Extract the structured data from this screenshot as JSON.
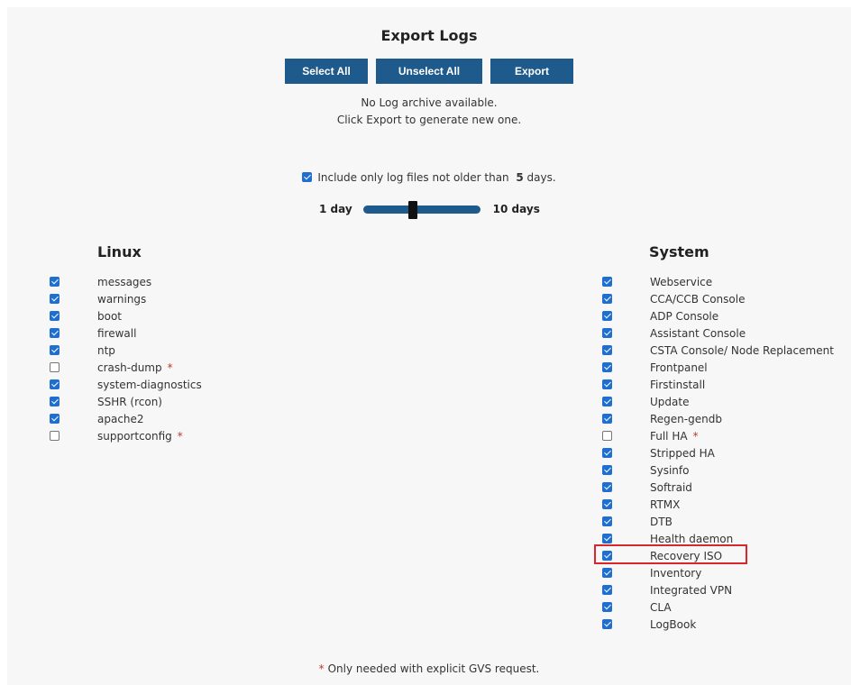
{
  "header": {
    "title": "Export Logs"
  },
  "toolbar": {
    "select_all": "Select All",
    "unselect_all": "Unselect All",
    "export": "Export"
  },
  "status": {
    "line1": "No Log archive available.",
    "line2": "Click Export to generate new one."
  },
  "filter": {
    "checked": true,
    "prefix": "Include only log files not older than",
    "days": "5",
    "suffix": "days."
  },
  "slider": {
    "min_label": "1 day",
    "max_label": "10 days",
    "value": 5,
    "min": 1,
    "max": 10
  },
  "linux": {
    "heading": "Linux",
    "items": [
      {
        "label": "messages",
        "checked": true,
        "star": false
      },
      {
        "label": "warnings",
        "checked": true,
        "star": false
      },
      {
        "label": "boot",
        "checked": true,
        "star": false
      },
      {
        "label": "firewall",
        "checked": true,
        "star": false
      },
      {
        "label": "ntp",
        "checked": true,
        "star": false
      },
      {
        "label": "crash-dump",
        "checked": false,
        "star": true
      },
      {
        "label": "system-diagnostics",
        "checked": true,
        "star": false
      },
      {
        "label": "SSHR (rcon)",
        "checked": true,
        "star": false
      },
      {
        "label": "apache2",
        "checked": true,
        "star": false
      },
      {
        "label": "supportconfig",
        "checked": false,
        "star": true
      }
    ]
  },
  "system": {
    "heading": "System",
    "items": [
      {
        "label": "Webservice",
        "checked": true,
        "star": false
      },
      {
        "label": "CCA/CCB Console",
        "checked": true,
        "star": false
      },
      {
        "label": "ADP Console",
        "checked": true,
        "star": false
      },
      {
        "label": "Assistant Console",
        "checked": true,
        "star": false
      },
      {
        "label": "CSTA Console/ Node Replacement",
        "checked": true,
        "star": false
      },
      {
        "label": "Frontpanel",
        "checked": true,
        "star": false
      },
      {
        "label": "Firstinstall",
        "checked": true,
        "star": false
      },
      {
        "label": "Update",
        "checked": true,
        "star": false
      },
      {
        "label": "Regen-gendb",
        "checked": true,
        "star": false
      },
      {
        "label": "Full HA",
        "checked": false,
        "star": true
      },
      {
        "label": "Stripped HA",
        "checked": true,
        "star": false
      },
      {
        "label": "Sysinfo",
        "checked": true,
        "star": false
      },
      {
        "label": "Softraid",
        "checked": true,
        "star": false
      },
      {
        "label": "RTMX",
        "checked": true,
        "star": false
      },
      {
        "label": "DTB",
        "checked": true,
        "star": false
      },
      {
        "label": "Health daemon",
        "checked": true,
        "star": false
      },
      {
        "label": "Recovery ISO",
        "checked": true,
        "star": false
      },
      {
        "label": "Inventory",
        "checked": true,
        "star": false
      },
      {
        "label": "Integrated VPN",
        "checked": true,
        "star": false
      },
      {
        "label": "CLA",
        "checked": true,
        "star": false
      },
      {
        "label": "LogBook",
        "checked": true,
        "star": false
      }
    ]
  },
  "footnote": {
    "star": "*",
    "text": "Only needed with explicit GVS request."
  },
  "star_symbol": "*",
  "colors": {
    "button_bg": "#1e5a8c",
    "checkbox_on": "#1e6fd0",
    "star": "#c0392b",
    "highlight": "#d9262b"
  }
}
